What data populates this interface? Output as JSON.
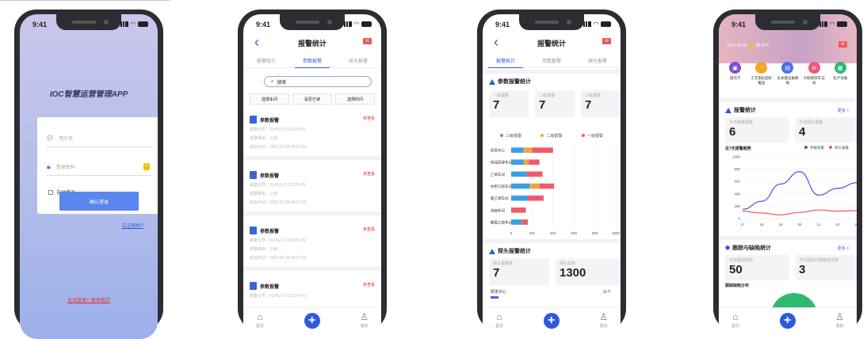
{
  "status_time": "9:41",
  "login": {
    "app_title": "IOC智慧运营管理APP",
    "username_placeholder": "用户名",
    "password_placeholder": "登录密码",
    "remember_label": "自动登录",
    "login_button": "确认登录",
    "forgot_link": "忘记密码?",
    "contact_link": "无法登录？联系我们"
  },
  "alarm_list": {
    "title": "报警统计",
    "tabs": [
      "报警统计",
      "参数报警",
      "探头报警"
    ],
    "active_tab": 1,
    "search_placeholder": "搜索",
    "filters": [
      "选择车间",
      "是否已读",
      "选择时间"
    ],
    "items": [
      {
        "title": "参数报警",
        "state": "未查看",
        "code": "报警位号：FLH5Z-LT-31370-PV",
        "level": "报警等级：三级",
        "time": "起始时间：2022-05-26 09:27:53"
      },
      {
        "title": "参数报警",
        "state": "未查看",
        "code": "报警位号：FLH5Z-LT-31370-PV",
        "level": "报警等级：三级",
        "time": "起始时间：2022-05-26 09:27:53"
      },
      {
        "title": "参数报警",
        "state": "未查看",
        "code": "报警位号：FLH5Z-LT-31370-PV",
        "level": "报警等级：三级",
        "time": "起始时间：2022-05-26 09:27:53"
      },
      {
        "title": "参数报警",
        "state": "未查看",
        "code": "报警位号：FLH5Z-LT-31370-PV",
        "level": "",
        "time": ""
      }
    ]
  },
  "stats": {
    "title": "报警统计",
    "tabs": [
      "报警统计",
      "参数报警",
      "探头报警"
    ],
    "active_tab": 0,
    "param_section": "参数报警统计",
    "level_boxes": [
      {
        "label": "一级报警",
        "value": "7"
      },
      {
        "label": "二级报警",
        "value": "7"
      },
      {
        "label": "三级报警",
        "value": "7"
      }
    ],
    "legend": [
      "三级报警",
      "二级报警",
      "一级报警"
    ],
    "probe_section": "探头报警统计",
    "probe_boxes": [
      {
        "label": "探头报警数",
        "value": "7"
      },
      {
        "label": "探头总数",
        "value": "1300"
      }
    ],
    "probe_row_label": "研发中心",
    "probe_row_value": "11个"
  },
  "home": {
    "date": "2022-05-26",
    "weather": "晴 29℃",
    "quick": [
      {
        "label": "操作卡",
        "color": "#7b4fd6",
        "icon": "card-icon"
      },
      {
        "label": "工艺指标超标推送",
        "color": "#f5a623",
        "icon": "gauge-icon"
      },
      {
        "label": "主关键设备数据",
        "color": "#4a6cf0",
        "icon": "device-icon"
      },
      {
        "label": "大联锁停车记录",
        "color": "#ee5a7a",
        "icon": "stop-icon"
      },
      {
        "label": "生产日报",
        "color": "#2fba72",
        "icon": "report-icon"
      }
    ],
    "alarm_section": "报警统计",
    "more": "更多 >",
    "today_param_label": "今日参数报警",
    "today_param_value": "6",
    "today_probe_label": "今日探头报警",
    "today_probe_value": "4",
    "trend_title": "近7天报警趋势",
    "trend_legend": [
      "参数报警",
      "探头报警"
    ],
    "track_section": "跟踪与缺陷统计",
    "today_track_label": "今日跟踪缺陷",
    "today_track_value": "50",
    "today_handle_label": "今日跟踪问题修改次数",
    "today_handle_value": "3",
    "defect_dist": "跟踪缺陷分布"
  },
  "nav": {
    "home": "首页",
    "mine": "我的"
  },
  "chart_data": [
    {
      "type": "bar",
      "title": "",
      "orientation": "horizontal",
      "categories": [
        "研发中心",
        "轻烃回收车间",
        "乙烯车间",
        "共用工程车间",
        "氯乙烯车间",
        "烧碱车间",
        "聚氯乙烯车间"
      ],
      "series": [
        {
          "name": "三级报警",
          "color": "#3ba0e3",
          "values": [
            120,
            120,
            150,
            180,
            160,
            0,
            100
          ]
        },
        {
          "name": "二级报警",
          "color": "#f0a33a",
          "values": [
            80,
            50,
            0,
            90,
            0,
            0,
            0
          ]
        },
        {
          "name": "一级报警",
          "color": "#ef5a6a",
          "values": [
            200,
            100,
            150,
            140,
            150,
            140,
            60
          ]
        }
      ],
      "xlim": [
        0,
        1000
      ],
      "xticks": [
        0,
        200,
        400,
        600,
        800,
        1000
      ]
    },
    {
      "type": "line",
      "title": "近7天报警趋势",
      "x": [
        17,
        18,
        19,
        20,
        21,
        22,
        23
      ],
      "series": [
        {
          "name": "参数报警",
          "color": "#3c55e6",
          "values": [
            150,
            280,
            560,
            760,
            380,
            490,
            580
          ]
        },
        {
          "name": "探头报警",
          "color": "#ef5a5a",
          "values": [
            120,
            90,
            60,
            100,
            140,
            120,
            130
          ]
        }
      ],
      "ylim": [
        0,
        1000
      ],
      "yticks": [
        0,
        200,
        400,
        600,
        800,
        1000
      ]
    }
  ]
}
